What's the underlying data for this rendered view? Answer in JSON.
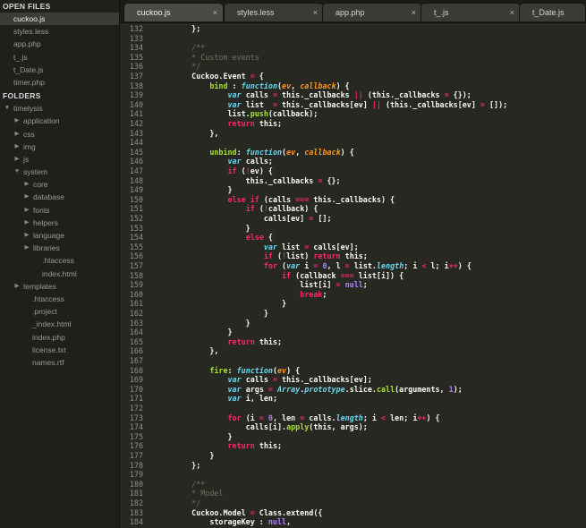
{
  "sidebar": {
    "open_files_heading": "OPEN FILES",
    "open_files": [
      {
        "label": "cuckoo.js",
        "active": true
      },
      {
        "label": "styles.less",
        "active": false
      },
      {
        "label": "app.php",
        "active": false
      },
      {
        "label": "t_.js",
        "active": false
      },
      {
        "label": "t_Date.js",
        "active": false
      },
      {
        "label": "timer.php",
        "active": false
      }
    ],
    "folders_heading": "FOLDERS",
    "tree": [
      {
        "label": "timelysis",
        "depth": 0,
        "arrow": "down"
      },
      {
        "label": "application",
        "depth": 1,
        "arrow": "right"
      },
      {
        "label": "css",
        "depth": 1,
        "arrow": "right"
      },
      {
        "label": "img",
        "depth": 1,
        "arrow": "right"
      },
      {
        "label": "js",
        "depth": 1,
        "arrow": "right"
      },
      {
        "label": "system",
        "depth": 1,
        "arrow": "down"
      },
      {
        "label": "core",
        "depth": 2,
        "arrow": "right"
      },
      {
        "label": "database",
        "depth": 2,
        "arrow": "right"
      },
      {
        "label": "fonts",
        "depth": 2,
        "arrow": "right"
      },
      {
        "label": "helpers",
        "depth": 2,
        "arrow": "right"
      },
      {
        "label": "language",
        "depth": 2,
        "arrow": "right"
      },
      {
        "label": "libraries",
        "depth": 2,
        "arrow": "right"
      },
      {
        "label": ".htaccess",
        "depth": 2,
        "arrow": "none"
      },
      {
        "label": "index.html",
        "depth": 2,
        "arrow": "none"
      },
      {
        "label": "templates",
        "depth": 1,
        "arrow": "right"
      },
      {
        "label": ".htaccess",
        "depth": 1,
        "arrow": "none"
      },
      {
        "label": ".project",
        "depth": 1,
        "arrow": "none"
      },
      {
        "label": "_index.html",
        "depth": 1,
        "arrow": "none"
      },
      {
        "label": "index.php",
        "depth": 1,
        "arrow": "none"
      },
      {
        "label": "license.txt",
        "depth": 1,
        "arrow": "none"
      },
      {
        "label": "names.rtf",
        "depth": 1,
        "arrow": "none"
      }
    ]
  },
  "tabs": [
    {
      "label": "cuckoo.js",
      "active": true,
      "close": "×"
    },
    {
      "label": "styles.less",
      "active": false,
      "close": "×"
    },
    {
      "label": "app.php",
      "active": false,
      "close": "×"
    },
    {
      "label": "t_.js",
      "active": false,
      "close": "×"
    },
    {
      "label": "t_Date.js",
      "active": false,
      "close": ""
    }
  ],
  "editor": {
    "lines": [
      {
        "n": "132",
        "segs": [
          [
            "d",
            "    };"
          ]
        ]
      },
      {
        "n": "133",
        "segs": []
      },
      {
        "n": "134",
        "segs": [
          [
            "c",
            "    /**"
          ]
        ]
      },
      {
        "n": "135",
        "segs": [
          [
            "c",
            "    * Custom events"
          ]
        ]
      },
      {
        "n": "136",
        "segs": [
          [
            "c",
            "    */"
          ]
        ]
      },
      {
        "n": "137",
        "segs": [
          [
            "d",
            "    Cuckoo.Event "
          ],
          [
            "o",
            "="
          ],
          [
            "d",
            " {"
          ]
        ]
      },
      {
        "n": "138",
        "segs": [
          [
            "d",
            "        "
          ],
          [
            "f",
            "bind"
          ],
          [
            "d",
            " : "
          ],
          [
            "s",
            "function"
          ],
          [
            "d",
            "("
          ],
          [
            "p",
            "ev"
          ],
          [
            "d",
            ", "
          ],
          [
            "p",
            "callback"
          ],
          [
            "d",
            ") {"
          ]
        ]
      },
      {
        "n": "139",
        "segs": [
          [
            "d",
            "            "
          ],
          [
            "s",
            "var"
          ],
          [
            "d",
            " calls "
          ],
          [
            "o",
            "="
          ],
          [
            "d",
            " this._callbacks "
          ],
          [
            "o",
            "||"
          ],
          [
            "d",
            " (this._callbacks "
          ],
          [
            "o",
            "="
          ],
          [
            "d",
            " {});"
          ]
        ]
      },
      {
        "n": "140",
        "segs": [
          [
            "d",
            "            "
          ],
          [
            "s",
            "var"
          ],
          [
            "d",
            " list  "
          ],
          [
            "o",
            "="
          ],
          [
            "d",
            " this._callbacks[ev] "
          ],
          [
            "o",
            "||"
          ],
          [
            "d",
            " (this._callbacks[ev] "
          ],
          [
            "o",
            "="
          ],
          [
            "d",
            " []);"
          ]
        ]
      },
      {
        "n": "141",
        "segs": [
          [
            "d",
            "            list."
          ],
          [
            "f",
            "push"
          ],
          [
            "d",
            "(callback);"
          ]
        ]
      },
      {
        "n": "142",
        "segs": [
          [
            "d",
            "            "
          ],
          [
            "k",
            "return"
          ],
          [
            "d",
            " this;"
          ]
        ]
      },
      {
        "n": "143",
        "segs": [
          [
            "d",
            "        },"
          ]
        ]
      },
      {
        "n": "144",
        "segs": []
      },
      {
        "n": "145",
        "segs": [
          [
            "d",
            "        "
          ],
          [
            "f",
            "unbind"
          ],
          [
            "d",
            ": "
          ],
          [
            "s",
            "function"
          ],
          [
            "d",
            "("
          ],
          [
            "p",
            "ev"
          ],
          [
            "d",
            ", "
          ],
          [
            "p",
            "callback"
          ],
          [
            "d",
            ") {"
          ]
        ]
      },
      {
        "n": "146",
        "segs": [
          [
            "d",
            "            "
          ],
          [
            "s",
            "var"
          ],
          [
            "d",
            " calls;"
          ]
        ]
      },
      {
        "n": "147",
        "segs": [
          [
            "d",
            "            "
          ],
          [
            "k",
            "if"
          ],
          [
            "d",
            " ("
          ],
          [
            "o",
            "!"
          ],
          [
            "d",
            "ev) {"
          ]
        ]
      },
      {
        "n": "148",
        "segs": [
          [
            "d",
            "                this._callbacks "
          ],
          [
            "o",
            "="
          ],
          [
            "d",
            " {};"
          ]
        ]
      },
      {
        "n": "149",
        "segs": [
          [
            "d",
            "            }"
          ]
        ]
      },
      {
        "n": "150",
        "segs": [
          [
            "d",
            "            "
          ],
          [
            "k",
            "else if"
          ],
          [
            "d",
            " (calls "
          ],
          [
            "o",
            "==="
          ],
          [
            "d",
            " this._callbacks) {"
          ]
        ]
      },
      {
        "n": "151",
        "segs": [
          [
            "d",
            "                "
          ],
          [
            "k",
            "if"
          ],
          [
            "d",
            " ("
          ],
          [
            "o",
            "!"
          ],
          [
            "d",
            "callback) {"
          ]
        ]
      },
      {
        "n": "152",
        "segs": [
          [
            "d",
            "                    calls[ev] "
          ],
          [
            "o",
            "="
          ],
          [
            "d",
            " [];"
          ]
        ]
      },
      {
        "n": "153",
        "segs": [
          [
            "d",
            "                }"
          ]
        ]
      },
      {
        "n": "154",
        "segs": [
          [
            "d",
            "                "
          ],
          [
            "k",
            "else"
          ],
          [
            "d",
            " {"
          ]
        ]
      },
      {
        "n": "155",
        "segs": [
          [
            "d",
            "                    "
          ],
          [
            "s",
            "var"
          ],
          [
            "d",
            " list "
          ],
          [
            "o",
            "="
          ],
          [
            "d",
            " calls[ev];"
          ]
        ]
      },
      {
        "n": "156",
        "segs": [
          [
            "d",
            "                    "
          ],
          [
            "k",
            "if"
          ],
          [
            "d",
            " ("
          ],
          [
            "o",
            "!"
          ],
          [
            "d",
            "list) "
          ],
          [
            "k",
            "return"
          ],
          [
            "d",
            " this;"
          ]
        ]
      },
      {
        "n": "157",
        "segs": [
          [
            "d",
            "                    "
          ],
          [
            "k",
            "for"
          ],
          [
            "d",
            " ("
          ],
          [
            "s",
            "var"
          ],
          [
            "d",
            " i "
          ],
          [
            "o",
            "="
          ],
          [
            "d",
            " "
          ],
          [
            "n",
            "0"
          ],
          [
            "d",
            ", l "
          ],
          [
            "o",
            "="
          ],
          [
            "d",
            " list."
          ],
          [
            "s",
            "length"
          ],
          [
            "d",
            "; i "
          ],
          [
            "o",
            "<"
          ],
          [
            "d",
            " l; i"
          ],
          [
            "o",
            "++"
          ],
          [
            "d",
            ") {"
          ]
        ]
      },
      {
        "n": "158",
        "segs": [
          [
            "d",
            "                        "
          ],
          [
            "k",
            "if"
          ],
          [
            "d",
            " (callback "
          ],
          [
            "o",
            "==="
          ],
          [
            "d",
            " list[i]) {"
          ]
        ]
      },
      {
        "n": "159",
        "segs": [
          [
            "d",
            "                            list[i] "
          ],
          [
            "o",
            "="
          ],
          [
            "d",
            " "
          ],
          [
            "n",
            "null"
          ],
          [
            "d",
            ";"
          ]
        ]
      },
      {
        "n": "160",
        "segs": [
          [
            "d",
            "                            "
          ],
          [
            "k",
            "break"
          ],
          [
            "d",
            ";"
          ]
        ]
      },
      {
        "n": "161",
        "segs": [
          [
            "d",
            "                        }"
          ]
        ]
      },
      {
        "n": "162",
        "segs": [
          [
            "d",
            "                    }"
          ]
        ]
      },
      {
        "n": "163",
        "segs": [
          [
            "d",
            "                }"
          ]
        ]
      },
      {
        "n": "164",
        "segs": [
          [
            "d",
            "            }"
          ]
        ]
      },
      {
        "n": "165",
        "segs": [
          [
            "d",
            "            "
          ],
          [
            "k",
            "return"
          ],
          [
            "d",
            " this;"
          ]
        ]
      },
      {
        "n": "166",
        "segs": [
          [
            "d",
            "        },"
          ]
        ]
      },
      {
        "n": "167",
        "segs": []
      },
      {
        "n": "168",
        "segs": [
          [
            "d",
            "        "
          ],
          [
            "f",
            "fire"
          ],
          [
            "d",
            ": "
          ],
          [
            "s",
            "function"
          ],
          [
            "d",
            "("
          ],
          [
            "p",
            "ev"
          ],
          [
            "d",
            ") {"
          ]
        ]
      },
      {
        "n": "169",
        "segs": [
          [
            "d",
            "            "
          ],
          [
            "s",
            "var"
          ],
          [
            "d",
            " calls "
          ],
          [
            "o",
            "="
          ],
          [
            "d",
            " this._callbacks[ev];"
          ]
        ]
      },
      {
        "n": "170",
        "segs": [
          [
            "d",
            "            "
          ],
          [
            "s",
            "var"
          ],
          [
            "d",
            " args "
          ],
          [
            "o",
            "="
          ],
          [
            "d",
            " "
          ],
          [
            "s",
            "Array"
          ],
          [
            "d",
            "."
          ],
          [
            "s",
            "prototype"
          ],
          [
            "d",
            ".slice."
          ],
          [
            "f",
            "call"
          ],
          [
            "d",
            "(arguments, "
          ],
          [
            "n",
            "1"
          ],
          [
            "d",
            ");"
          ]
        ]
      },
      {
        "n": "171",
        "segs": [
          [
            "d",
            "            "
          ],
          [
            "s",
            "var"
          ],
          [
            "d",
            " i, len;"
          ]
        ]
      },
      {
        "n": "172",
        "segs": []
      },
      {
        "n": "173",
        "segs": [
          [
            "d",
            "            "
          ],
          [
            "k",
            "for"
          ],
          [
            "d",
            " (i "
          ],
          [
            "o",
            "="
          ],
          [
            "d",
            " "
          ],
          [
            "n",
            "0"
          ],
          [
            "d",
            ", len "
          ],
          [
            "o",
            "="
          ],
          [
            "d",
            " calls."
          ],
          [
            "s",
            "length"
          ],
          [
            "d",
            "; i "
          ],
          [
            "o",
            "<"
          ],
          [
            "d",
            " len; i"
          ],
          [
            "o",
            "++"
          ],
          [
            "d",
            ") {"
          ]
        ]
      },
      {
        "n": "174",
        "segs": [
          [
            "d",
            "                calls[i]."
          ],
          [
            "f",
            "apply"
          ],
          [
            "d",
            "(this, args);"
          ]
        ]
      },
      {
        "n": "175",
        "segs": [
          [
            "d",
            "            }"
          ]
        ]
      },
      {
        "n": "176",
        "segs": [
          [
            "d",
            "            "
          ],
          [
            "k",
            "return"
          ],
          [
            "d",
            " this;"
          ]
        ]
      },
      {
        "n": "177",
        "segs": [
          [
            "d",
            "        }"
          ]
        ]
      },
      {
        "n": "178",
        "segs": [
          [
            "d",
            "    };"
          ]
        ]
      },
      {
        "n": "179",
        "segs": []
      },
      {
        "n": "180",
        "segs": [
          [
            "c",
            "    /**"
          ]
        ]
      },
      {
        "n": "181",
        "segs": [
          [
            "c",
            "    * Model"
          ]
        ]
      },
      {
        "n": "182",
        "segs": [
          [
            "c",
            "    */"
          ]
        ]
      },
      {
        "n": "183",
        "segs": [
          [
            "d",
            "    Cuckoo.Model "
          ],
          [
            "o",
            "="
          ],
          [
            "d",
            " Class.extend({"
          ]
        ]
      },
      {
        "n": "184",
        "segs": [
          [
            "d",
            "        storageKey : "
          ],
          [
            "n",
            "null"
          ],
          [
            "d",
            ","
          ]
        ]
      }
    ]
  }
}
